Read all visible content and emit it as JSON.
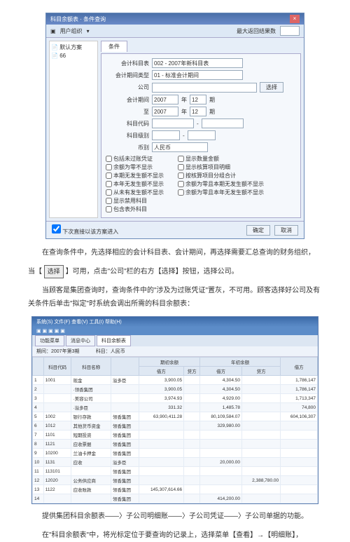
{
  "dialog": {
    "title": "科目余额表 · 条件查询",
    "toolbar_user": "用户组织",
    "toolbar_right": "最大返回结果数",
    "sidebar": [
      "默认方案",
      "66"
    ],
    "tab": "条件",
    "fields": {
      "account_table_lbl": "会计科目表",
      "account_table_val": "002 - 2007年新科目表",
      "period_type_lbl": "会计期间类型",
      "period_type_val": "01 - 标准会计期间",
      "company_lbl": "公司",
      "select_btn": "选择",
      "period_lbl": "会计期间",
      "year_from": "2007",
      "per_from": "12",
      "per_from_unit": "期",
      "year_to": "2007",
      "per_to": "12",
      "per_to_unit": "期",
      "to_lbl": "至",
      "code_lbl": "科目代码",
      "dash": "-",
      "level_lbl": "科目级别",
      "level_dash": "-",
      "currency_lbl": "币别",
      "currency_val": "人民币"
    },
    "checks_left": [
      "包括未过账凭证",
      "余额为零不显示",
      "本期无发生额不显示",
      "本年无发生额不显示",
      "从未有发生额不显示",
      "显示禁用科目",
      "包含表外科目"
    ],
    "checks_right": [
      "显示数量金额",
      "显示核算项目明细",
      "按核算项目分组合计",
      "余额为零且本期无发生额不显示",
      "余额为零且本年无发生额不显示"
    ],
    "footer_check": "下次直接以该方案进入",
    "ok": "确定",
    "cancel": "取消"
  },
  "para1a": "在查询条件中，先选择相应的会计科目表、会计期间，再选择需要汇总查询的财务组织，",
  "para1b_prefix": "当【",
  "para1b_btn": "选择",
  "para1b_suffix": "】可用，点击\"公司\"栏的右方【选择】按钮，选择公司。",
  "para2": "当顾客是集团查询时，查询条件中的\"涉及为过账凭证\"置灰，不可用。顾客选择好公司及有关条件后单击\"拟定\"时系统会调出所需的科目余额表：",
  "screen2": {
    "menubar": "系统(S)  文件(F)  查看(V)  工具(I)  帮助(H)",
    "tabs": [
      "功能菜单",
      "消息中心",
      "科目余额表"
    ],
    "period": "期间：2007年第3期",
    "metric_label": "科目：人民币",
    "cols": [
      "",
      "科目代码",
      "科目名称",
      "",
      "借方",
      "贷方",
      "借方",
      "贷方",
      "借方"
    ],
    "group_headers": [
      "",
      "期初余额",
      "年初余额"
    ],
    "rows": [
      {
        "n": "1",
        "code": "1001",
        "name": "现金",
        "org": "溢多臣",
        "d1": "3,900.05",
        "c1": "",
        "d2": "4,304.50",
        "c2": "",
        "d3": "1,786,147"
      },
      {
        "n": "2",
        "code": "",
        "name": "·领香集团",
        "org": "",
        "d1": "3,900.05",
        "c1": "",
        "d2": "4,304.50",
        "c2": "",
        "d3": "1,786,147"
      },
      {
        "n": "3",
        "code": "",
        "name": "·美容公司",
        "org": "",
        "d1": "3,974.93",
        "c1": "",
        "d2": "4,929.00",
        "c2": "",
        "d3": "1,713,347"
      },
      {
        "n": "4",
        "code": "",
        "name": "·溢多臣",
        "org": "",
        "d1": "331.32",
        "c1": "",
        "d2": "1,485.78",
        "c2": "",
        "d3": "74,800"
      },
      {
        "n": "5",
        "code": "1002",
        "name": "银行存款",
        "org": "领香集团",
        "d1": "63,900,411.28",
        "c1": "",
        "d2": "80,109,584.07",
        "c2": "",
        "d3": "604,106,307"
      },
      {
        "n": "6",
        "code": "1012",
        "name": "其他货币资金",
        "org": "领香集团",
        "d1": "",
        "c1": "",
        "d2": "329,980.00",
        "c2": "",
        "d3": ""
      },
      {
        "n": "7",
        "code": "1101",
        "name": "短期投资",
        "org": "领香集团",
        "d1": "",
        "c1": "",
        "d2": "",
        "c2": "",
        "d3": ""
      },
      {
        "n": "8",
        "code": "1121",
        "name": "应收票据",
        "org": "领香集团",
        "d1": "",
        "c1": "",
        "d2": "",
        "c2": "",
        "d3": ""
      },
      {
        "n": "9",
        "code": "10200",
        "name": "兰油卡押金",
        "org": "领香集团",
        "d1": "",
        "c1": "",
        "d2": "",
        "c2": "",
        "d3": ""
      },
      {
        "n": "10",
        "code": "1131",
        "name": "应收",
        "org": "溢多臣",
        "d1": "",
        "c1": "",
        "d2": "20,000.00",
        "c2": "",
        "d3": ""
      },
      {
        "n": "11",
        "code": "113101",
        "name": "",
        "org": "领香集团",
        "d1": "",
        "c1": "",
        "d2": "",
        "c2": "",
        "d3": ""
      },
      {
        "n": "12",
        "code": "12020",
        "name": "公务供应商",
        "org": "领香集团",
        "d1": "",
        "c1": "",
        "d2": "",
        "c2": "2,388,780.00",
        "d3": ""
      },
      {
        "n": "13",
        "code": "1122",
        "name": "应收账款",
        "org": "领香集团",
        "d1": "145,307,614.66",
        "c1": "",
        "d2": "",
        "c2": "",
        "d3": ""
      },
      {
        "n": "14",
        "code": "",
        "name": "",
        "org": "领香集团",
        "d1": "",
        "c1": "",
        "d2": "414,200.00",
        "c2": "",
        "d3": ""
      }
    ]
  },
  "para3": "提供集团科目余额表——〉子公司明细账——〉子公司凭证——〉子公司单据的功能。",
  "para4": "在\"科目余额表\"中，将光标定位于要查询的记录上，选择菜单【查看】→【明细账】，"
}
